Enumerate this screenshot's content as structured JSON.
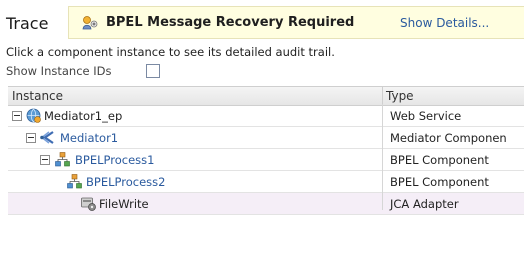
{
  "header": {
    "title": "Trace",
    "alert_message": "BPEL Message Recovery Required",
    "show_details_label": "Show Details..."
  },
  "instructions": "Click a component instance to see its detailed audit trail.",
  "show_instance_ids_label": "Show Instance IDs",
  "table": {
    "columns": [
      "Instance",
      "Type"
    ],
    "rows": [
      {
        "name": "Mediator1_ep",
        "type": "Web Service",
        "icon": "web-service-icon"
      },
      {
        "name": "Mediator1",
        "type": "Mediator Componen",
        "icon": "mediator-icon"
      },
      {
        "name": "BPELProcess1",
        "type": "BPEL Component",
        "icon": "bpel-process-icon"
      },
      {
        "name": "BPELProcess2",
        "type": "BPEL Component",
        "icon": "bpel-process-icon"
      },
      {
        "name": "FileWrite",
        "type": "JCA Adapter",
        "icon": "jca-adapter-icon"
      }
    ]
  },
  "colors": {
    "link": "#2a5a9e",
    "alert_background": "#fffee0",
    "selected_row": "#f5eef7"
  }
}
